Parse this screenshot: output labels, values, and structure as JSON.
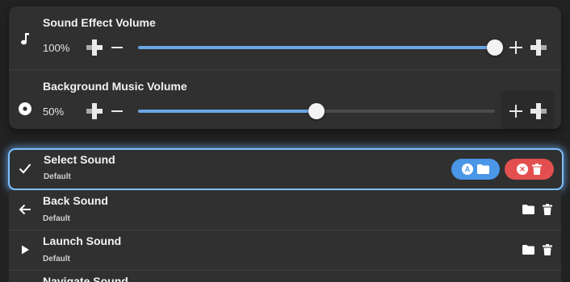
{
  "volume": {
    "sfx": {
      "title": "Sound Effect Volume",
      "value_text": "100%",
      "level": 1.0,
      "icon": "music-note-icon"
    },
    "music": {
      "title": "Background Music Volume",
      "value_text": "50%",
      "level": 0.5,
      "icon": "disc-icon"
    }
  },
  "sounds": [
    {
      "label": "Select Sound",
      "sub": "Default",
      "icon": "check-icon",
      "selected": true,
      "actions": {
        "choose_badge": "A",
        "remove_badge": "✕"
      }
    },
    {
      "label": "Back Sound",
      "sub": "Default",
      "icon": "arrow-left-icon"
    },
    {
      "label": "Launch Sound",
      "sub": "Default",
      "icon": "play-icon"
    },
    {
      "label": "Navigate Sound",
      "sub": "",
      "icon": ""
    }
  ],
  "colors": {
    "accent": "#6aa6e6",
    "focus": "#7ec0ff",
    "blue_pill": "#4a97e8",
    "red_pill": "#e34f4f"
  }
}
